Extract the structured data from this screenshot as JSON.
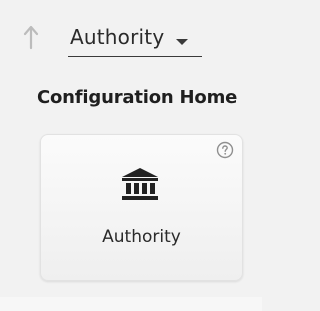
{
  "nav": {
    "up_icon": "arrow-up-icon",
    "dropdown": {
      "selected": "Authority",
      "caret_icon": "caret-down-icon"
    }
  },
  "page": {
    "title": "Configuration Home"
  },
  "cards": [
    {
      "label": "Authority",
      "icon": "building-columns-icon",
      "help_icon": "help-circle-icon"
    }
  ],
  "colors": {
    "background": "#f2f2f2",
    "card_background": "#f7f7f7",
    "text": "#1f1f1f",
    "muted_icon": "#b5b5b5"
  }
}
